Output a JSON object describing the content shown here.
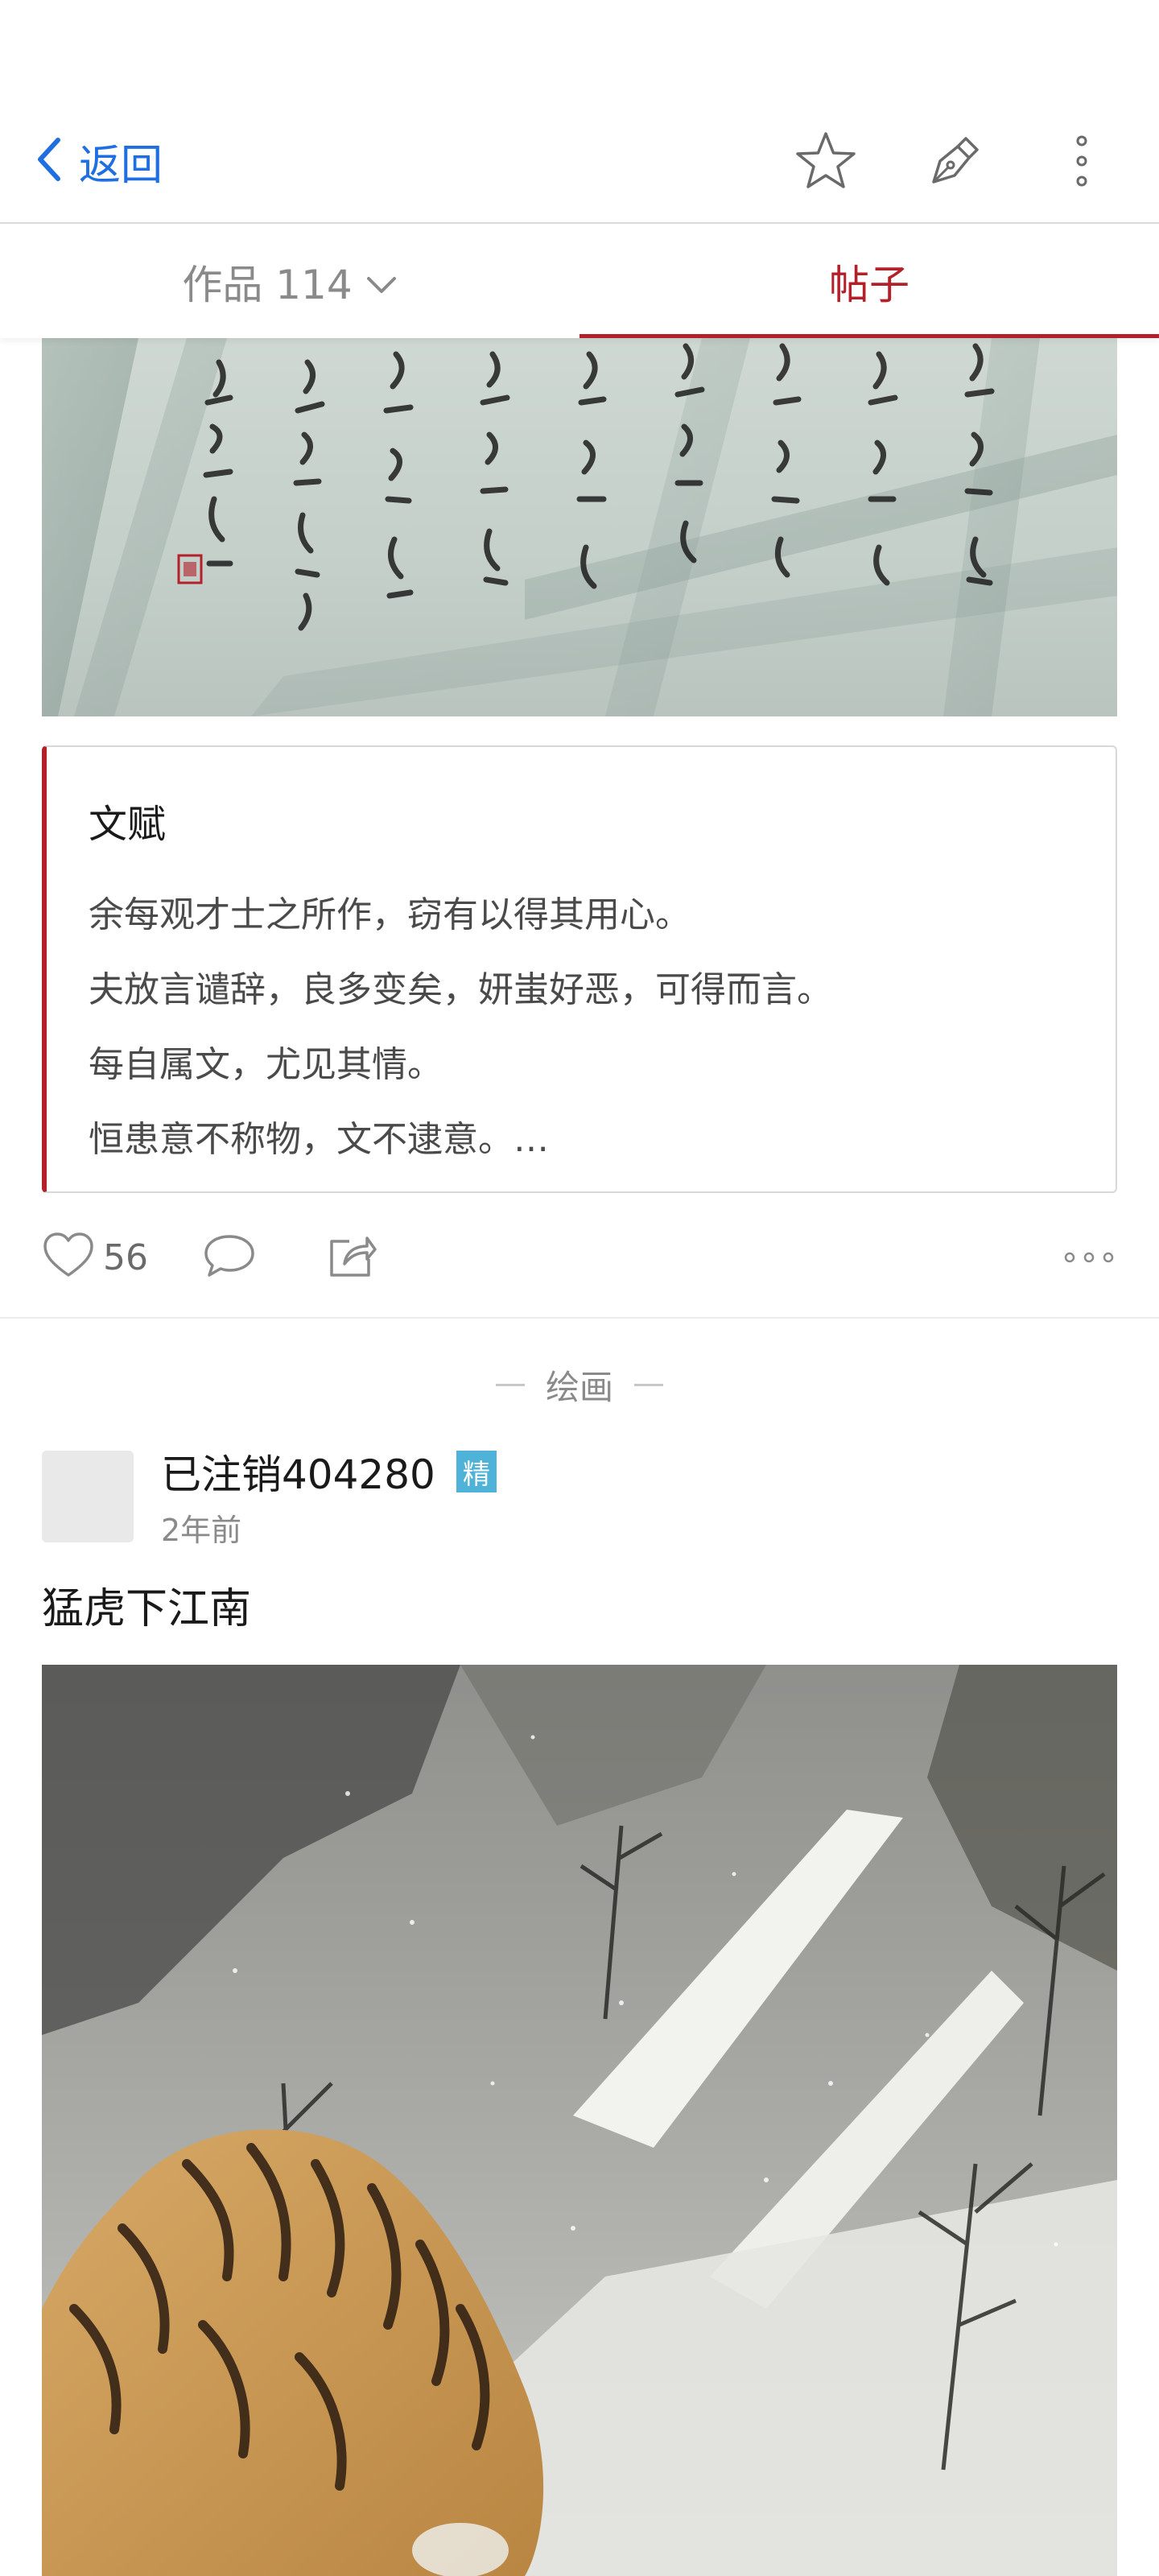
{
  "topbar": {
    "back_label": "返回",
    "icons": [
      "chevron-left-icon",
      "star-icon",
      "pen-icon",
      "more-vertical-icon"
    ]
  },
  "tabs": [
    {
      "label": "作品 114",
      "active": false
    },
    {
      "label": "帖子",
      "active": true
    }
  ],
  "quote": {
    "title": "文赋",
    "lines": [
      "余每观才士之所作，窃有以得其用心。",
      "夫放言谴辞，良多变矣，妍蚩好恶，可得而言。",
      "每自属文，尤见其情。",
      "恒患意不称物，文不逮意。…"
    ]
  },
  "actions": {
    "like_count": "56",
    "icons": [
      "heart-icon",
      "comment-icon",
      "share-icon",
      "more-horizontal-icon"
    ]
  },
  "section": {
    "label": "绘画"
  },
  "post": {
    "username": "已注销404280",
    "badge": "精",
    "time": "2年前",
    "title": "猛虎下江南"
  },
  "colors": {
    "accent_red": "#b3202a",
    "link_blue": "#1f6fe0",
    "badge_blue": "#4fb3d9"
  }
}
